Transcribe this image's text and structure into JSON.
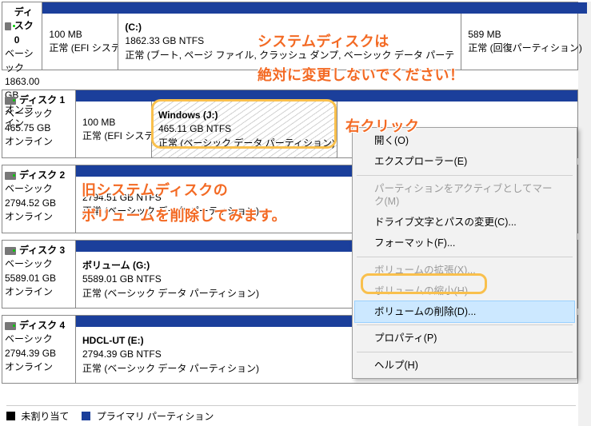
{
  "disks": [
    {
      "name": "ディスク 0",
      "type": "ベーシック",
      "size": "1863.00 GB",
      "status": "オンライン",
      "parts": [
        {
          "title": "",
          "size": "100 MB",
          "status": "正常 (EFI システム"
        },
        {
          "title": "(C:)",
          "size": "1862.33 GB NTFS",
          "status": "正常 (ブート, ページ ファイル, クラッシュ ダンプ, ベーシック データ パーテ"
        },
        {
          "title": "",
          "size": "589 MB",
          "status": "正常 (回復パーティション)"
        }
      ]
    },
    {
      "name": "ディスク 1",
      "type": "ベーシック",
      "size": "465.75 GB",
      "status": "オンライン",
      "parts": [
        {
          "title": "",
          "size": "100 MB",
          "status": "正常 (EFI システム"
        },
        {
          "title": "Windows  (J:)",
          "size": "465.11 GB NTFS",
          "status": "正常 (ベーシック データ パーティション)"
        },
        {
          "title": "",
          "size": "",
          "status": ""
        }
      ]
    },
    {
      "name": "ディスク 2",
      "type": "ベーシック",
      "size": "2794.52 GB",
      "status": "オンライン",
      "parts": [
        {
          "title": "",
          "size": "2794.51 GB NTFS",
          "status": "正常 (ベーシック データ パーティション)"
        }
      ]
    },
    {
      "name": "ディスク 3",
      "type": "ベーシック",
      "size": "5589.01 GB",
      "status": "オンライン",
      "parts": [
        {
          "title": "ボリューム  (G:)",
          "size": "5589.01 GB NTFS",
          "status": "正常 (ベーシック データ パーティション)"
        }
      ]
    },
    {
      "name": "ディスク 4",
      "type": "ベーシック",
      "size": "2794.39 GB",
      "status": "オンライン",
      "parts": [
        {
          "title": "HDCL-UT  (E:)",
          "size": "2794.39 GB NTFS",
          "status": "正常 (ベーシック データ パーティション)"
        }
      ]
    }
  ],
  "legend": {
    "unallocated": "未割り当て",
    "primary": "プライマリ パーティション"
  },
  "annotations": {
    "l1": "システムディスクは",
    "l2": "絶対に変更しないでください！",
    "rc": "右クリック",
    "o1": "旧システムディスクの",
    "o2": "ボリュームを削除してみます。"
  },
  "menu": {
    "open": "開く(O)",
    "explorer": "エクスプローラー(E)",
    "active": "パーティションをアクティブとしてマーク(M)",
    "change": "ドライブ文字とパスの変更(C)...",
    "format": "フォーマット(F)...",
    "extend": "ボリュームの拡張(X)...",
    "shrink": "ボリュームの縮小(H)...",
    "delete": "ボリュームの削除(D)...",
    "property": "プロパティ(P)",
    "help": "ヘルプ(H)"
  }
}
